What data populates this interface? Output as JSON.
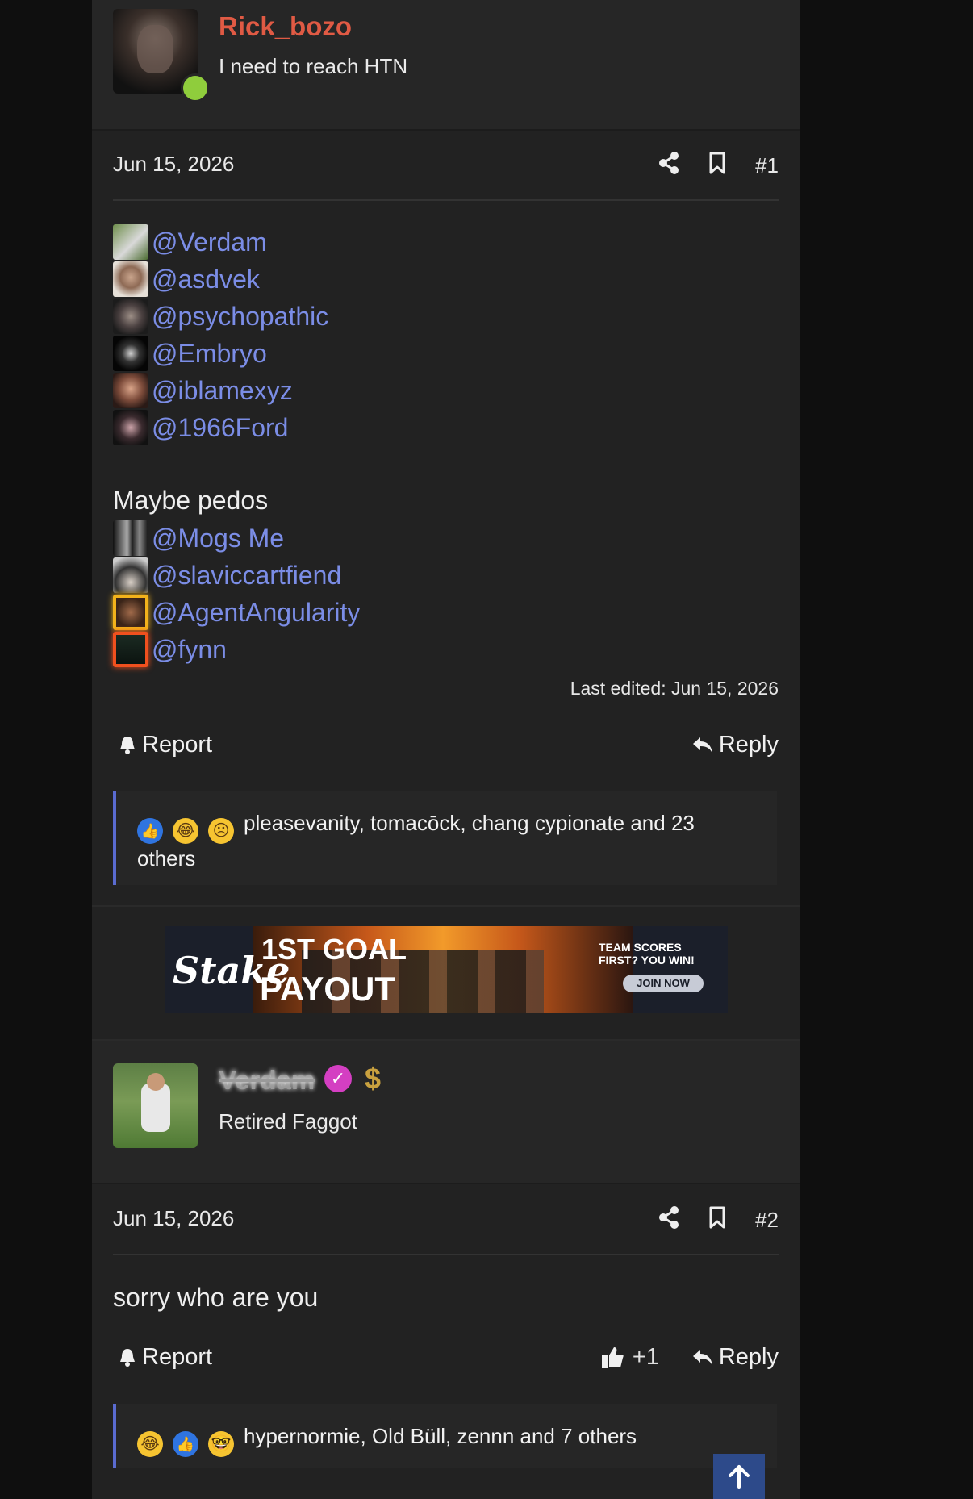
{
  "post1": {
    "username": "Rick_bozo",
    "user_title": "I need to reach HTN",
    "date": "Jun 15, 2026",
    "number": "#1",
    "mentions": [
      "@Verdam",
      "@asdvek",
      "@psychopathic",
      "@Embryo",
      "@iblamexyz",
      "@1966Ford"
    ],
    "section_label": "Maybe pedos",
    "mentions2": [
      "@Mogs Me",
      "@slaviccartfiend",
      "@AgentAngularity",
      "@fynn"
    ],
    "last_edited": "Last edited: Jun 15, 2026",
    "report_label": "Report",
    "reply_label": "Reply",
    "reactions_text": "pleasevanity, tomacōck, chang cypionate and 23 others"
  },
  "ad": {
    "brand": "Stake",
    "headline_top": "1ST GOAL",
    "headline_bottom": "PAYOUT",
    "tagline": "TEAM SCORES FIRST? YOU WIN!",
    "cta": "JOIN NOW"
  },
  "post2": {
    "username": "Verdam",
    "user_title": "Retired Faggot",
    "date": "Jun 15, 2026",
    "number": "#2",
    "body": "sorry who are you",
    "report_label": "Report",
    "like_count": "+1",
    "reply_label": "Reply",
    "reactions_text": "hypernormie, Old Büll, zennn and 7 others"
  },
  "colors": {
    "username_red": "#e05a44",
    "mention_blue": "#7b8de6",
    "online_green": "#8fcd3c",
    "reaction_border": "#5a6bd0",
    "scroll_top_bg": "#2d4a8a"
  }
}
